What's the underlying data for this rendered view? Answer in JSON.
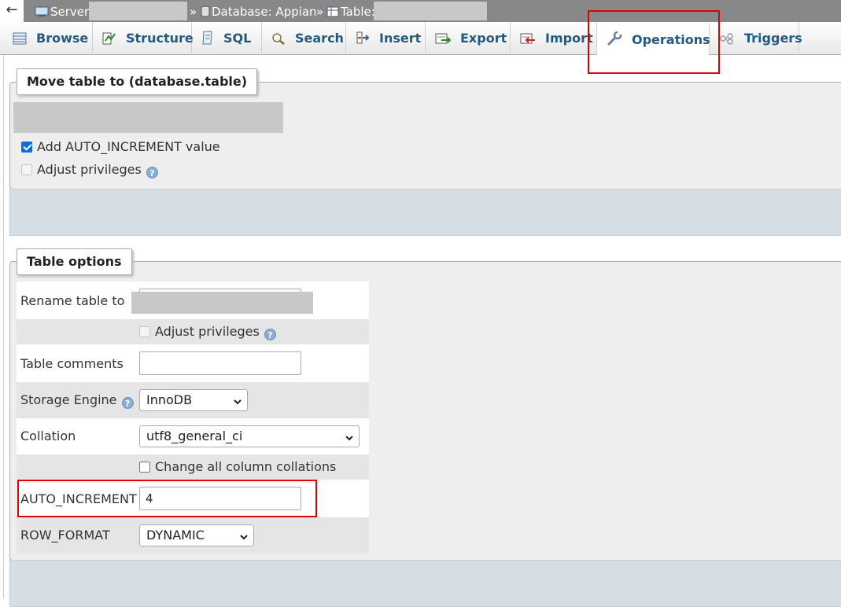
{
  "breadcrumb": {
    "back": "←",
    "server_label": "Server:",
    "separator": "»",
    "database_label": "Database: Appian",
    "table_label": "Table:"
  },
  "tabs": [
    {
      "label": "Browse",
      "icon": "browse-icon"
    },
    {
      "label": "Structure",
      "icon": "structure-icon"
    },
    {
      "label": "SQL",
      "icon": "sql-icon"
    },
    {
      "label": "Search",
      "icon": "search-icon"
    },
    {
      "label": "Insert",
      "icon": "insert-icon"
    },
    {
      "label": "Export",
      "icon": "export-icon"
    },
    {
      "label": "Import",
      "icon": "import-icon"
    },
    {
      "label": "Operations",
      "icon": "wrench-icon",
      "active": true
    },
    {
      "label": "Triggers",
      "icon": "triggers-icon"
    }
  ],
  "move_table": {
    "legend": "Move table to (database.table)",
    "add_auto_increment": {
      "label": "Add AUTO_INCREMENT value",
      "checked": true
    },
    "adjust_privileges": {
      "label": "Adjust privileges",
      "checked": false,
      "disabled": true
    }
  },
  "table_options": {
    "legend": "Table options",
    "rename_label": "Rename table to",
    "adjust_privileges_label": "Adjust privileges",
    "comments_label": "Table comments",
    "comments_value": "",
    "storage_engine_label": "Storage Engine",
    "storage_engine_value": "InnoDB",
    "collation_label": "Collation",
    "collation_value": "utf8_general_ci",
    "change_collations_label": "Change all column collations",
    "auto_increment_label": "AUTO_INCREMENT",
    "auto_increment_value": "4",
    "row_format_label": "ROW_FORMAT",
    "row_format_value": "DYNAMIC"
  },
  "help_glyph": "?",
  "colors": {
    "tab_text": "#235a81",
    "highlight": "#e00000",
    "checkbox_checked": "#0b6fd9",
    "footer": "#d5dde5"
  }
}
